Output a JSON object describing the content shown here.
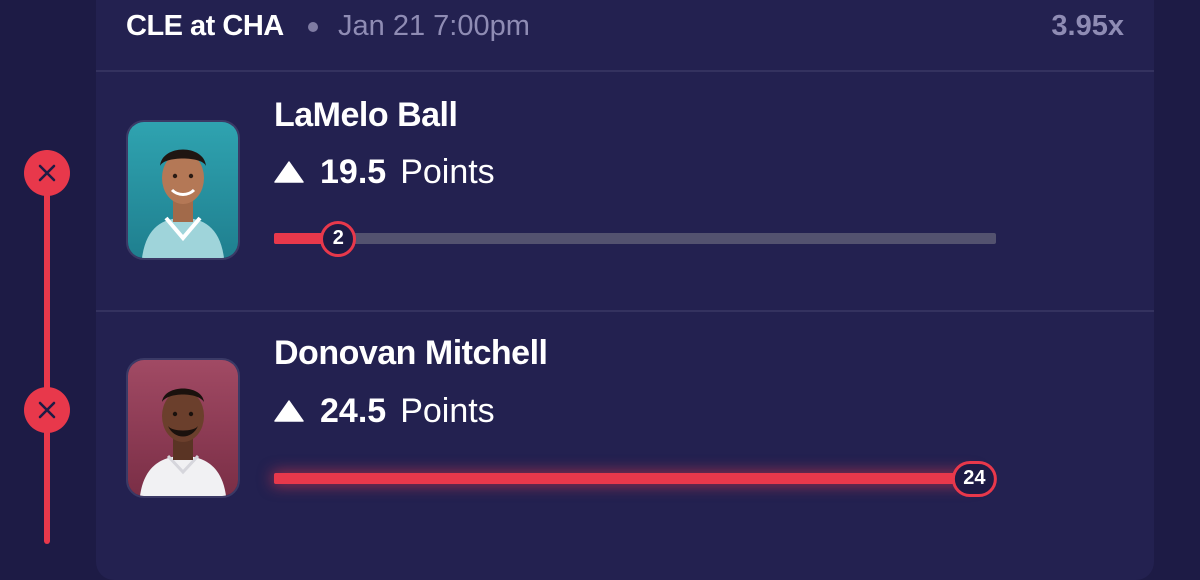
{
  "header": {
    "matchup": "CLE at CHA",
    "game_time": "Jan 21 7:00pm",
    "multiplier": "3.95x"
  },
  "colors": {
    "background": "#1d1b45",
    "card": "#232150",
    "accent_red": "#e8384b",
    "muted_text": "#8f8cb4",
    "track": "#53526f"
  },
  "picks": [
    {
      "player_name": "LaMelo Ball",
      "direction_icon": "up-triangle-icon",
      "line": "19.5",
      "stat": "Points",
      "actual": "2",
      "progress_fraction": 0.089,
      "result_icon": "x-icon",
      "result": "lost"
    },
    {
      "player_name": "Donovan Mitchell",
      "direction_icon": "up-triangle-icon",
      "line": "24.5",
      "stat": "Points",
      "actual": "24",
      "progress_fraction": 0.97,
      "result_icon": "x-icon",
      "result": "lost"
    }
  ]
}
